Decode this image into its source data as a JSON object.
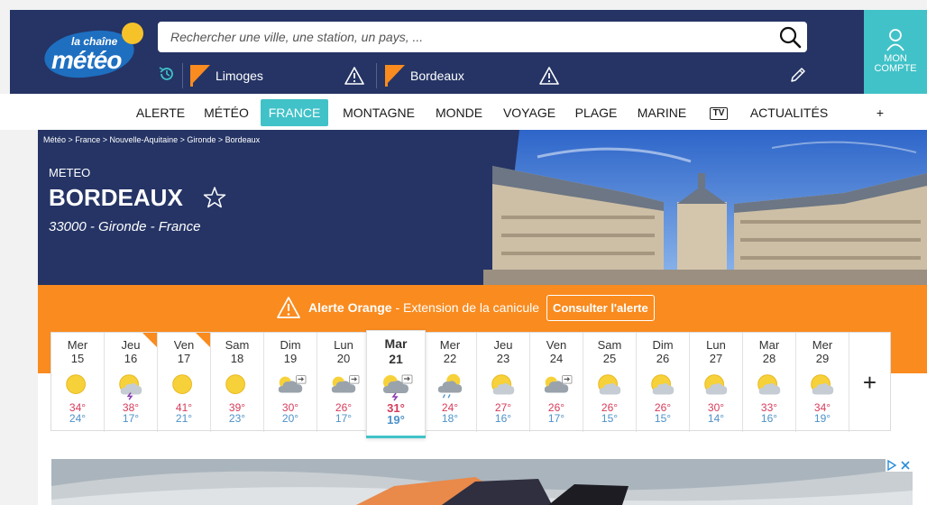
{
  "header": {
    "logo": {
      "small": "la chaîne",
      "big": "météo"
    },
    "search_placeholder": "Rechercher une ville, une station, un pays, ...",
    "favorites": [
      {
        "name": "Limoges"
      },
      {
        "name": "Bordeaux"
      }
    ],
    "account_label": [
      "MON",
      "COMPTE"
    ]
  },
  "nav": {
    "items": [
      {
        "label": "ALERTE"
      },
      {
        "label": "MÉTÉO"
      },
      {
        "label": "FRANCE"
      },
      {
        "label": "MONTAGNE"
      },
      {
        "label": "MONDE"
      },
      {
        "label": "VOYAGE"
      },
      {
        "label": "PLAGE"
      },
      {
        "label": "MARINE"
      },
      {
        "label": "TV"
      },
      {
        "label": "ACTUALITÉS"
      },
      {
        "label": "+"
      }
    ],
    "active": "FRANCE"
  },
  "hero": {
    "breadcrumb": "Météo > France > Nouvelle-Aquitaine > Gironde > Bordeaux",
    "label": "METEO",
    "city": "BORDEAUX",
    "location": "33000 - Gironde - France"
  },
  "alert": {
    "level": "Alerte Orange",
    "text": " - Extension de la canicule",
    "button": "Consulter l'alerte"
  },
  "forecast": {
    "days": [
      {
        "dn": "Mer",
        "dd": "15",
        "max": "34°",
        "min": "24°",
        "icon": "sun",
        "alert": false
      },
      {
        "dn": "Jeu",
        "dd": "16",
        "max": "38°",
        "min": "17°",
        "icon": "sun-storm",
        "alert": true
      },
      {
        "dn": "Ven",
        "dd": "17",
        "max": "41°",
        "min": "21°",
        "icon": "sun",
        "alert": true
      },
      {
        "dn": "Sam",
        "dd": "18",
        "max": "39°",
        "min": "23°",
        "icon": "sun",
        "alert": false
      },
      {
        "dn": "Dim",
        "dd": "19",
        "max": "30°",
        "min": "20°",
        "icon": "cloud-wind",
        "alert": false
      },
      {
        "dn": "Lun",
        "dd": "20",
        "max": "26°",
        "min": "17°",
        "icon": "cloud-wind",
        "alert": false
      },
      {
        "dn": "Mar",
        "dd": "21",
        "max": "31°",
        "min": "19°",
        "icon": "storm-wind",
        "alert": false,
        "today": true
      },
      {
        "dn": "Mer",
        "dd": "22",
        "max": "24°",
        "min": "18°",
        "icon": "rain",
        "alert": false
      },
      {
        "dn": "Jeu",
        "dd": "23",
        "max": "27°",
        "min": "16°",
        "icon": "sun-cloud",
        "alert": false
      },
      {
        "dn": "Ven",
        "dd": "24",
        "max": "26°",
        "min": "17°",
        "icon": "cloud-wind",
        "alert": false
      },
      {
        "dn": "Sam",
        "dd": "25",
        "max": "26°",
        "min": "15°",
        "icon": "sun-cloud",
        "alert": false
      },
      {
        "dn": "Dim",
        "dd": "26",
        "max": "26°",
        "min": "15°",
        "icon": "sun-cloud",
        "alert": false
      },
      {
        "dn": "Lun",
        "dd": "27",
        "max": "30°",
        "min": "14°",
        "icon": "sun-cloud",
        "alert": false
      },
      {
        "dn": "Mar",
        "dd": "28",
        "max": "33°",
        "min": "16°",
        "icon": "sun-cloud",
        "alert": false
      },
      {
        "dn": "Mer",
        "dd": "29",
        "max": "34°",
        "min": "19°",
        "icon": "sun-cloud",
        "alert": false
      }
    ],
    "more": "+"
  },
  "colors": {
    "navy": "#253465",
    "teal": "#41c2c8",
    "orange": "#f98b1f",
    "max_temp": "#d63b5a",
    "min_temp": "#4d91c9"
  }
}
